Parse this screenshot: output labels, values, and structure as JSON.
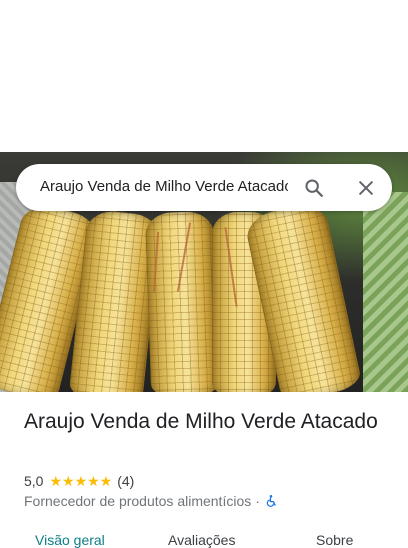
{
  "search": {
    "query": "Araujo Venda de Milho Verde Atacado"
  },
  "icons": {
    "search": "search-icon",
    "close": "close-icon",
    "accessibility": "wheelchair-icon"
  },
  "place": {
    "name": "Araujo Venda de Milho Verde Atacado",
    "rating": "5,0",
    "stars": "★★★★★",
    "review_count": "(4)",
    "category": "Fornecedor de produtos alimentícios",
    "separator": "·"
  },
  "tabs": [
    {
      "label": "Visão geral"
    },
    {
      "label": "Avaliações"
    },
    {
      "label": "Sobre"
    }
  ],
  "colors": {
    "accent": "#0b7f86",
    "star": "#fbbc04",
    "access": "#1a73e8"
  }
}
